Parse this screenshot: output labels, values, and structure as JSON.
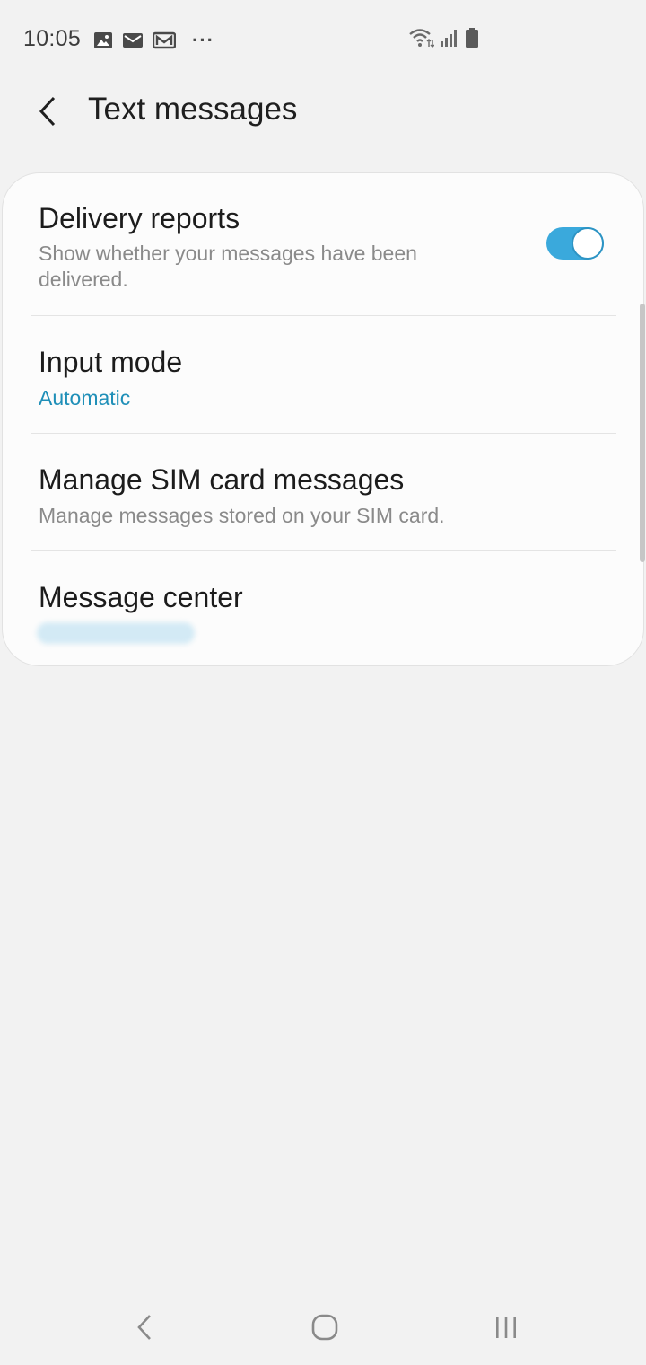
{
  "status_bar": {
    "time": "10:05",
    "more_indicator": "···",
    "icons": [
      "gallery-icon",
      "email-icon",
      "gmail-icon",
      "wifi-icon",
      "signal-icon",
      "battery-icon"
    ]
  },
  "header": {
    "title": "Text messages",
    "back_icon": "back-chevron-icon"
  },
  "settings": {
    "delivery_reports": {
      "title": "Delivery reports",
      "subtitle": "Show whether your messages have been delivered.",
      "enabled": true
    },
    "input_mode": {
      "title": "Input mode",
      "value": "Automatic"
    },
    "sim_messages": {
      "title": "Manage SIM card messages",
      "subtitle": "Manage messages stored on your SIM card."
    },
    "message_center": {
      "title": "Message center"
    }
  },
  "colors": {
    "accent": "#1f8fb8",
    "toggle_on": "#3aa9dc",
    "background": "#f2f2f2",
    "card": "#fcfcfc"
  },
  "nav_bar": {
    "icons": [
      "nav-back-icon",
      "nav-home-icon",
      "nav-recents-icon"
    ]
  }
}
